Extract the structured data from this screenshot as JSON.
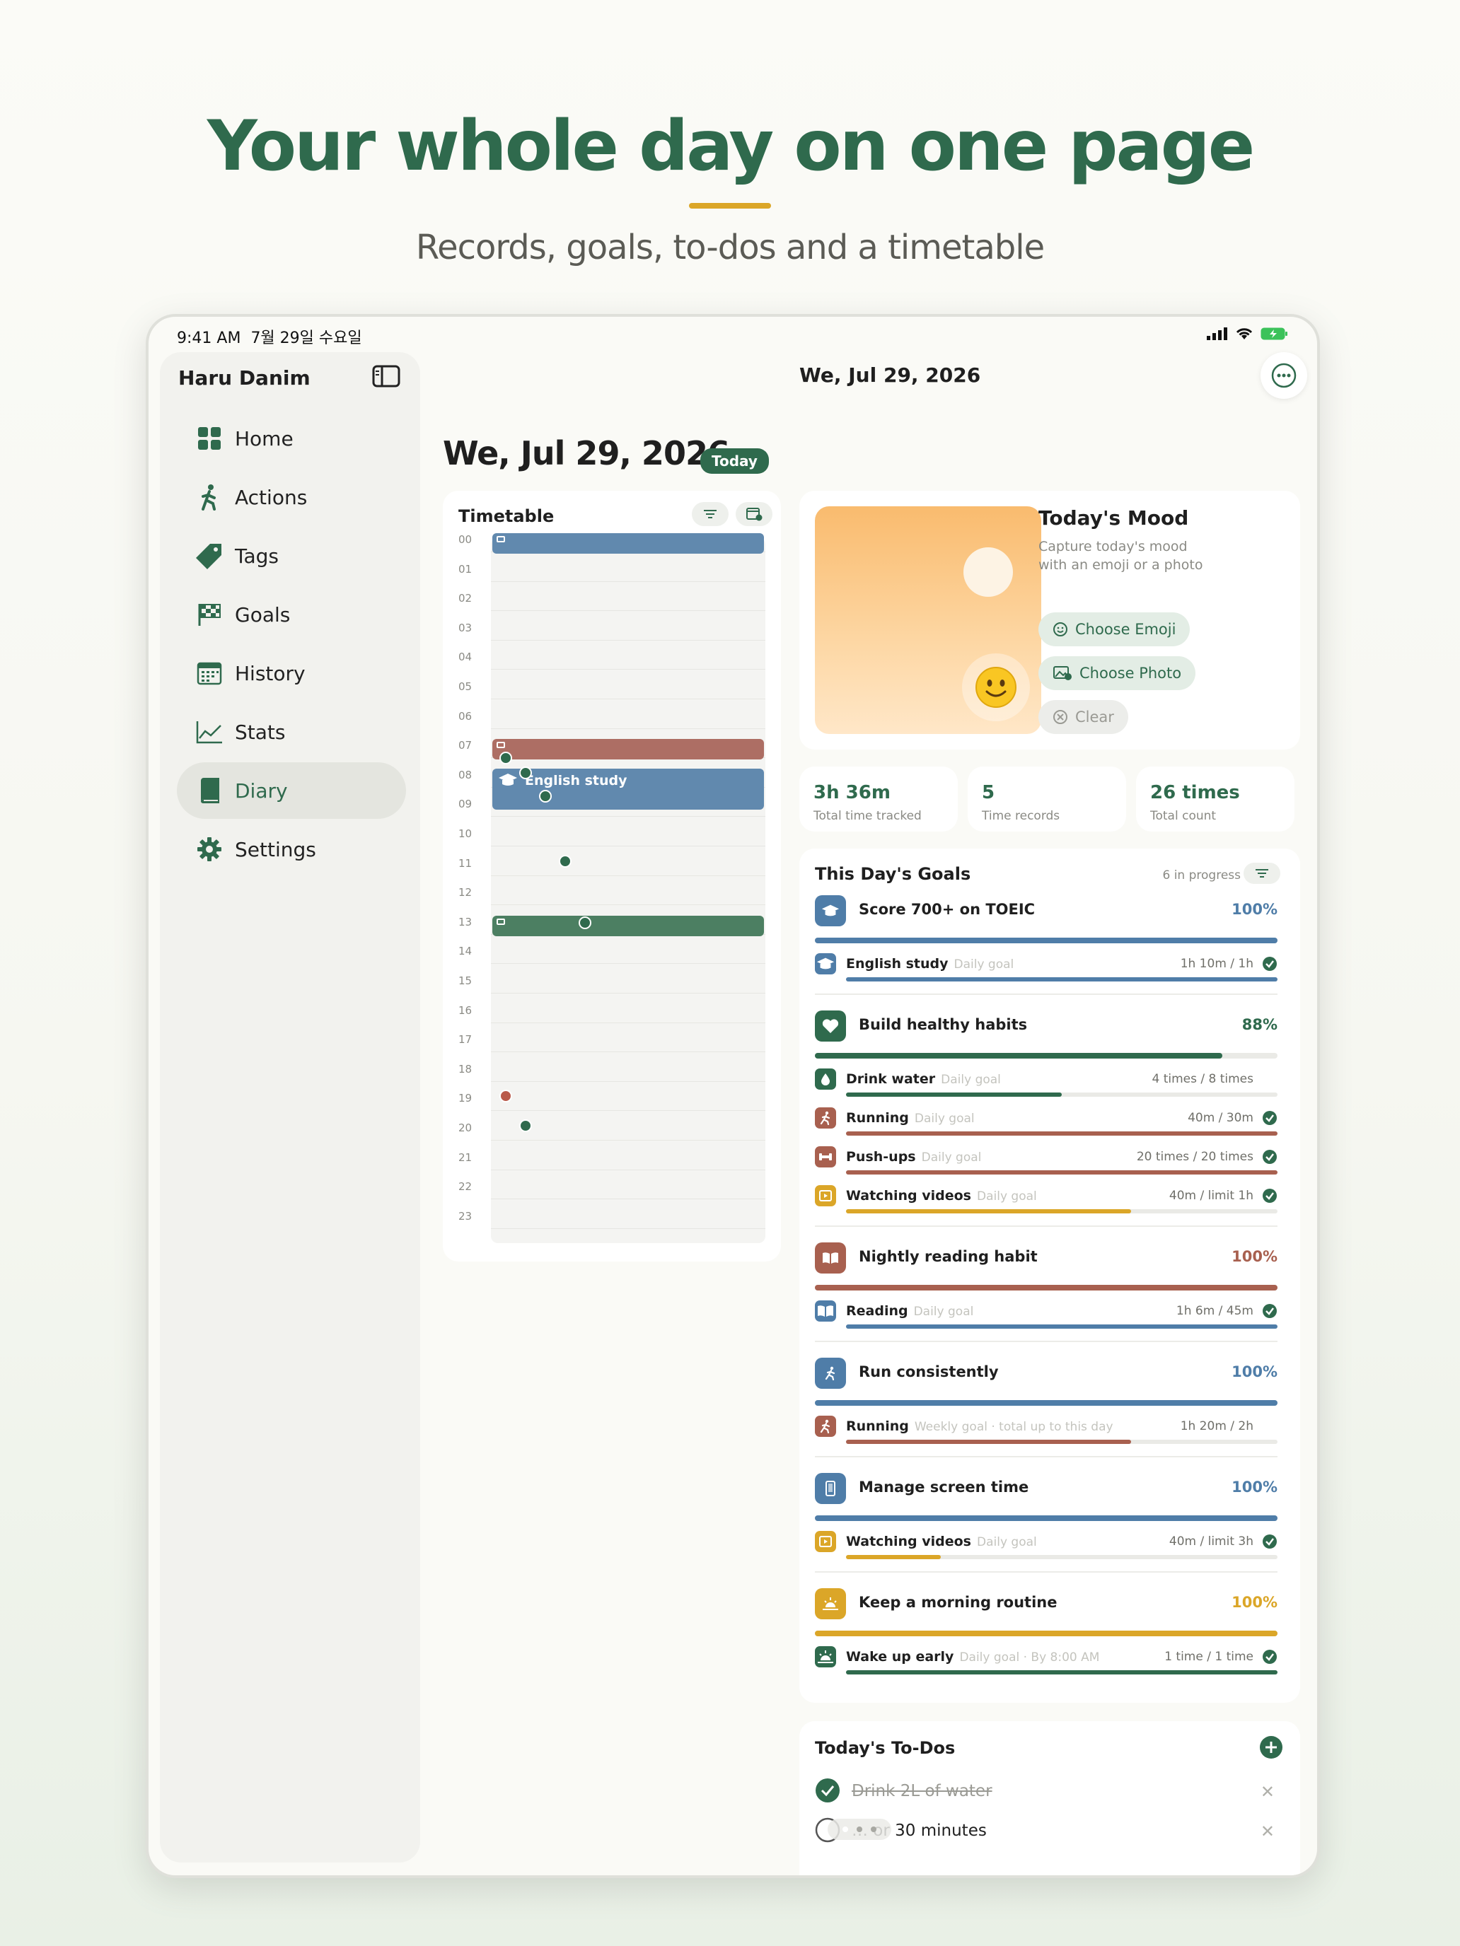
{
  "promo": {
    "headline": "Your whole day on one page",
    "subhead": "Records, goals, to-dos and a timetable"
  },
  "status": {
    "time": "9:41 AM",
    "date": "7월 29일 수요일"
  },
  "sidebar": {
    "app_name": "Haru Danim",
    "items": [
      {
        "label": "Home",
        "icon": "grid-icon"
      },
      {
        "label": "Actions",
        "icon": "walking-icon"
      },
      {
        "label": "Tags",
        "icon": "tag-icon"
      },
      {
        "label": "Goals",
        "icon": "checkered-flag-icon"
      },
      {
        "label": "History",
        "icon": "calendar-icon"
      },
      {
        "label": "Stats",
        "icon": "line-chart-icon"
      },
      {
        "label": "Diary",
        "icon": "book-icon",
        "active": true
      },
      {
        "label": "Settings",
        "icon": "gear-icon"
      }
    ]
  },
  "header": {
    "date": "We, Jul 29, 2026"
  },
  "page": {
    "title": "We, Jul 29, 2026",
    "badge": "Today"
  },
  "timetable": {
    "title": "Timetable",
    "hours": [
      "00",
      "01",
      "02",
      "03",
      "04",
      "05",
      "06",
      "07",
      "08",
      "09",
      "10",
      "11",
      "12",
      "13",
      "14",
      "15",
      "16",
      "17",
      "18",
      "19",
      "20",
      "21",
      "22",
      "23"
    ],
    "blocks": [
      {
        "start": 0.0,
        "end": 0.7,
        "color": "#6189ae",
        "label": ""
      },
      {
        "start": 7.0,
        "end": 7.7,
        "color": "#ad6e64",
        "label": ""
      },
      {
        "start": 8.0,
        "end": 9.4,
        "color": "#6189ae",
        "label": "English study"
      },
      {
        "start": 13.0,
        "end": 13.7,
        "color": "#4c7f62",
        "label": ""
      }
    ],
    "dots": [
      {
        "t": 7.5,
        "color": "#2f6a4d"
      },
      {
        "t": 8.0,
        "color": "#2f6a4d"
      },
      {
        "t": 8.8,
        "color": "#2f6a4d"
      },
      {
        "t": 11.0,
        "color": "#2f6a4d"
      },
      {
        "t": 13.1,
        "color": "#2f6a4d"
      },
      {
        "t": 19.0,
        "color": "#b95a4a"
      },
      {
        "t": 20.0,
        "color": "#2f6a4d"
      }
    ]
  },
  "mood": {
    "title": "Today's Mood",
    "description": "Capture today's mood with an emoji or a photo",
    "choose_emoji": "Choose Emoji",
    "choose_photo": "Choose Photo",
    "clear": "Clear"
  },
  "stats": [
    {
      "value": "3h 36m",
      "caption": "Total time tracked"
    },
    {
      "value": "5",
      "caption": "Time records"
    },
    {
      "value": "26 times",
      "caption": "Total count"
    }
  ],
  "goals": {
    "title": "This Day's Goals",
    "count_label": "6 in progress",
    "groups": [
      {
        "name": "Score 700+ on TOEIC",
        "pct": "100%",
        "progress": 1.0,
        "color": "#4f7da8",
        "icon": "graduation-cap-icon",
        "subs": [
          {
            "name": "English study",
            "type": "Daily goal",
            "value": "1h 10m / 1h",
            "progress": 1.0,
            "color": "#4f7da8",
            "done": true,
            "icon": "graduation-cap-icon"
          }
        ]
      },
      {
        "name": "Build healthy habits",
        "pct": "88%",
        "progress": 0.88,
        "color": "#2f6a4d",
        "icon": "heart-icon",
        "subs": [
          {
            "name": "Drink water",
            "type": "Daily goal",
            "value": "4 times / 8 times",
            "progress": 0.5,
            "color": "#2f6a4d",
            "done": false,
            "icon": "water-drop-icon"
          },
          {
            "name": "Running",
            "type": "Daily goal",
            "value": "40m / 30m",
            "progress": 1.0,
            "color": "#a8604f",
            "done": true,
            "icon": "running-icon"
          },
          {
            "name": "Push-ups",
            "type": "Daily goal",
            "value": "20 times / 20 times",
            "progress": 1.0,
            "color": "#a8604f",
            "done": true,
            "icon": "dumbbell-icon"
          },
          {
            "name": "Watching videos",
            "type": "Daily goal",
            "value": "40m / limit 1h",
            "progress": 0.66,
            "color": "#dba628",
            "done": true,
            "icon": "play-video-icon"
          }
        ]
      },
      {
        "name": "Nightly reading habit",
        "pct": "100%",
        "progress": 1.0,
        "color": "#a8604f",
        "icon": "open-book-icon",
        "subs": [
          {
            "name": "Reading",
            "type": "Daily goal",
            "value": "1h 6m / 45m",
            "progress": 1.0,
            "color": "#4f7da8",
            "done": true,
            "icon": "open-book-icon"
          }
        ]
      },
      {
        "name": "Run consistently",
        "pct": "100%",
        "progress": 1.0,
        "color": "#4f7da8",
        "icon": "running-icon",
        "subs": [
          {
            "name": "Running",
            "type": "Weekly goal · total up to this day",
            "value": "1h 20m / 2h",
            "progress": 0.66,
            "color": "#a8604f",
            "done": false,
            "icon": "running-icon"
          }
        ]
      },
      {
        "name": "Manage screen time",
        "pct": "100%",
        "progress": 1.0,
        "color": "#4f7da8",
        "icon": "phone-icon",
        "subs": [
          {
            "name": "Watching videos",
            "type": "Daily goal",
            "value": "40m / limit 3h",
            "progress": 0.22,
            "color": "#dba628",
            "done": true,
            "icon": "play-video-icon"
          }
        ]
      },
      {
        "name": "Keep a morning routine",
        "pct": "100%",
        "progress": 1.0,
        "color": "#dba628",
        "icon": "sunrise-icon",
        "subs": [
          {
            "name": "Wake up early",
            "type": "Daily goal · By 8:00 AM",
            "value": "1 time / 1 time",
            "progress": 1.0,
            "color": "#2f6a4d",
            "done": true,
            "icon": "sunrise-icon"
          }
        ]
      }
    ]
  },
  "todos": {
    "title": "Today's To-Dos",
    "items": [
      {
        "text": "Drink 2L of water",
        "done": true
      },
      {
        "text": "… or 30 minutes",
        "done": false
      }
    ]
  }
}
